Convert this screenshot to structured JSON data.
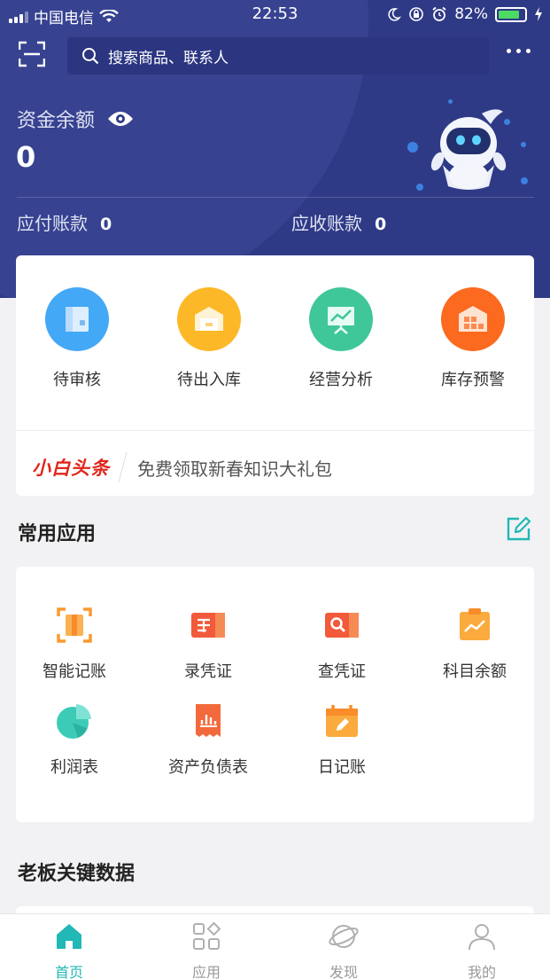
{
  "status_bar": {
    "carrier": "中国电信",
    "time": "22:53",
    "battery_percent": "82%"
  },
  "header": {
    "search_placeholder": "搜索商品、联系人",
    "balance_label": "资金余额",
    "balance_value": "0",
    "payable_label": "应付账款",
    "payable_value": "0",
    "receivable_label": "应收账款",
    "receivable_value": "0"
  },
  "quick_actions": [
    {
      "label": "待审核",
      "icon": "book-icon",
      "color": "#43a8f5"
    },
    {
      "label": "待出入库",
      "icon": "warehouse-box-icon",
      "color": "#fdb827"
    },
    {
      "label": "经营分析",
      "icon": "analysis-board-icon",
      "color": "#3fc79a"
    },
    {
      "label": "库存预警",
      "icon": "inventory-warehouse-icon",
      "color": "#fb6a1f"
    }
  ],
  "promo": {
    "brand": "小白头条",
    "text": "免费领取新春知识大礼包"
  },
  "common_apps": {
    "title": "常用应用",
    "items": [
      {
        "label": "智能记账",
        "icon": "smart-bookkeeping-icon"
      },
      {
        "label": "录凭证",
        "icon": "enter-voucher-icon"
      },
      {
        "label": "查凭证",
        "icon": "search-voucher-icon"
      },
      {
        "label": "科目余额",
        "icon": "account-balance-icon"
      },
      {
        "label": "利润表",
        "icon": "pie-chart-icon"
      },
      {
        "label": "资产负债表",
        "icon": "balance-sheet-icon"
      },
      {
        "label": "日记账",
        "icon": "calendar-journal-icon"
      }
    ]
  },
  "key_data": {
    "title": "老板关键数据"
  },
  "bottom_nav": [
    {
      "label": "首页",
      "icon": "home-icon",
      "active": true
    },
    {
      "label": "应用",
      "icon": "apps-grid-icon",
      "active": false
    },
    {
      "label": "发现",
      "icon": "planet-icon",
      "active": false
    },
    {
      "label": "我的",
      "icon": "profile-icon",
      "active": false
    }
  ],
  "colors": {
    "header_bg": "#2f3a86",
    "accent": "#22b8b6",
    "promo_brand": "#e1251b"
  }
}
